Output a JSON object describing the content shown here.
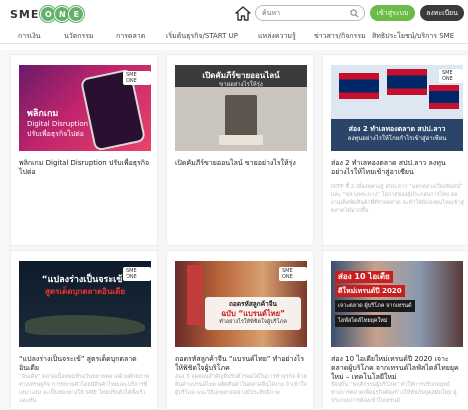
{
  "header": {
    "logo_text": "SME",
    "logo_letters": [
      "O",
      "N",
      "E"
    ],
    "search_placeholder": "ค้นหา",
    "login_label": "เข้าสู่ระบบ",
    "register_label": "ลงทะเบียน"
  },
  "nav": {
    "items": [
      "การเงิน",
      "นวัตกรรม",
      "การตลาด",
      "เริ่มต้นธุรกิจ/START UP",
      "แหล่งความรู้",
      "ข่าวสาร/กิจกรรม",
      "สิทธิประโยชน์/บริการ SME"
    ]
  },
  "cards": [
    {
      "title": "พลิกเกม Digital Disruption ปรับเพื่อธุรกิจไปต่อ",
      "thumb_caption": [
        "พลิกเกม",
        "Digital Disruption",
        "ปรับเพื่อธุรกิจไปต่อ"
      ],
      "badge": "SME ONE",
      "excerpt": ""
    },
    {
      "title": "เปิดคัมภีร์ขายออนไลน์ ขายอย่างไรให้รุ่ง",
      "thumb_caption": [
        "เปิดคัมภีร์ขายออนไลน์",
        "ขายอย่างไรให้รุ่ง"
      ],
      "badge": "",
      "excerpt": ""
    },
    {
      "title": "ส่อง 2 ทำเลทองตลาด สปป.ลาว ลงทุนอย่างไรให้ไทยเข้าสู่อาเซียน",
      "thumb_caption": [
        "ส่อง 2 ทำเลทองตลาด สปป.ลาว",
        "ลงทุนอย่างไรให้โกยกำไรเข้าสู่อาเซียน"
      ],
      "badge": "SME ONE",
      "excerpt": "DITP ชี้ 2 เมืองหลวงสู่ สปป.ลาว “นครหลวงเวียงจันทน์” และ “หลวงพระบาง” โอกาสของผู้ประกอบการไทย ผลงานเด็ดทิดสินค้าที่ดีรายตลาด จะทำให้นักลงทุนไทยเข้าสู่ตลาดได้มากขึ้น"
    },
    {
      "title": "“แปลงร่างเป็นจระเข้” สูตรเด็ดบุกตลาดอินเดีย",
      "thumb_caption": [
        "“แปลงร่างเป็นจระเข้”",
        "สูตรเด็ดบุกตลาดอินเดีย"
      ],
      "badge": "SME ONE",
      "excerpt": "“อินเดีย” ตลาดเนื้อหอมที่รอวันขยายตลาดด้วยศักยภาพทางเศรษฐกิจ การขยายตัวโดยมีสินค้าไทยและบริการที่เหมาะสม จะเป็นช่องทางให้ SME ไทยปรับตัวได้ทั้งเร็วและทัน"
    },
    {
      "title": "ถอดรหัสลูกค้าจีน “แบรนด์ไทย” ทำอย่างไรให้พิชิตใจผู้บริโภค",
      "thumb_caption": [
        "ถอดรหัสลูกค้าจีน",
        "ฉบับ “แบรนด์ไทย”",
        "ทำอย่างไรให้พิชิตใจผู้บริโภค"
      ],
      "badge": "SME ONE",
      "excerpt": "ส่อง 3 จุดอ่อนสำคัญที่ปรับตัวรอดได้ในการทำธุรกิจ ด้วยสินค้าแบรนด์ไทย ผลิตสินค้าในตลาดจีนได้ง่าย ถ้าเข้าใจผู้บริโภค แนะวิธีบุกตลาดอย่างมีประสิทธิภาพ"
    },
    {
      "title": "ส่อง 10 ไอเดียใหม่เทรนด์ปี 2020 เจาะตลาดผู้บริโภค จากเทรนด์ไลฟ์สไตล์ไทยยุคใหม่ – เทคโนโลยีใหม่",
      "thumb_caption": [
        "ส่อง 10 ไอเดีย",
        "ดีใหม่เทรนด์ปี 2020",
        "เจาะตลาด ผู้บริโภค จากเทรนด์",
        "ไลฟ์สไตล์ไทยยุคใหม่"
      ],
      "badge": "",
      "excerpt": "ปัจจุบัน “พฤติกรรมผู้บริโภค” ทำให้การปรับกลยุทธ์ทางการตลาดเพื่อธุรกิจต้องก้าวให้ทันกับยุคสมัยใหม่ ผู้ประกอบการต้องเข้าใจเทรนด์"
    }
  ],
  "colors": {
    "brand_green": "#63b16a",
    "login_bg": "#6cbb47",
    "register_bg": "#3a3a3a"
  }
}
